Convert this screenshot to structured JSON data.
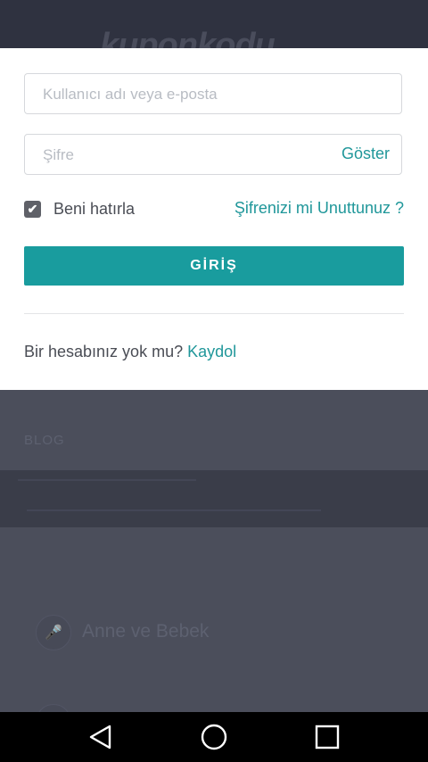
{
  "background": {
    "logo_text": "kuponkodu",
    "blog_label": "BLOG",
    "category_label": "Anne ve Bebek"
  },
  "login": {
    "username_placeholder": "Kullanıcı adı veya e-posta",
    "password_placeholder": "Şifre",
    "show_password_label": "Göster",
    "remember_label": "Beni hatırla",
    "remember_checked": true,
    "forgot_label": "Şifrenizi mi Unuttunuz ?",
    "submit_label": "GİRİŞ",
    "no_account_text": "Bir hesabınız yok mu?",
    "signup_label": "Kaydol"
  },
  "colors": {
    "accent": "#199c9e",
    "link": "#20979a",
    "overlay": "#4a4d5a"
  },
  "navbar": {
    "back_icon": "back-triangle-icon",
    "home_icon": "home-circle-icon",
    "recents_icon": "recents-square-icon"
  }
}
